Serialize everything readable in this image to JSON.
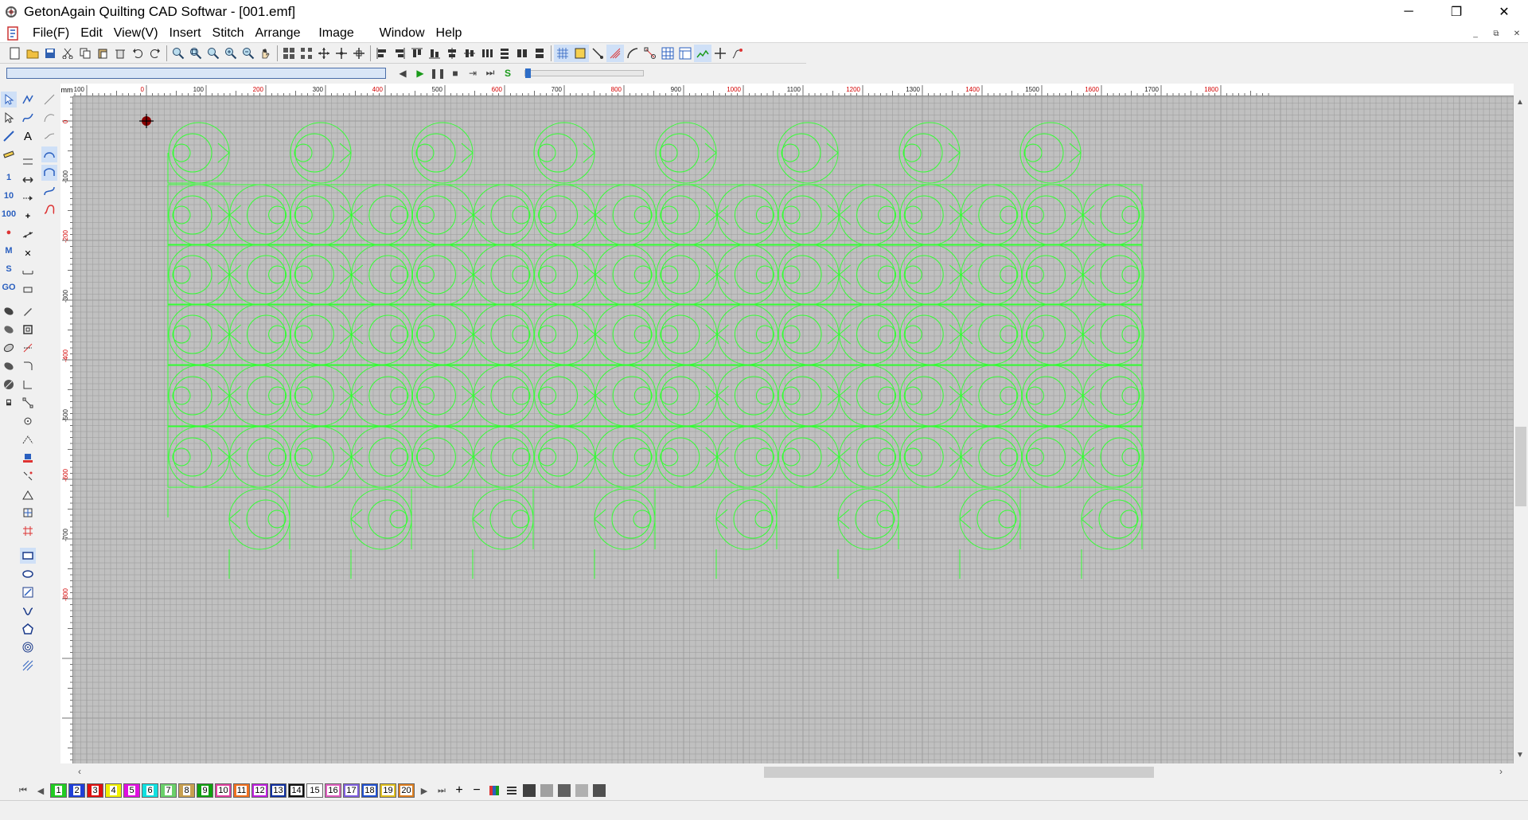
{
  "window": {
    "title": "GetonAgain Quilting CAD Softwar - [001.emf]",
    "controls": {
      "minimize": "─",
      "maximize": "❐",
      "close": "✕"
    }
  },
  "menu": {
    "items": [
      "File(F)",
      "Edit",
      "View(V)",
      "Insert",
      "Stitch",
      "Arrange",
      "  Image",
      "    Window",
      "Help"
    ],
    "mdi": {
      "minimize": "_",
      "restore": "⧉",
      "close": "✕"
    }
  },
  "ruler": {
    "unit": "mm",
    "x_ticks": [
      "-100",
      "0",
      "100",
      "200",
      "300",
      "400",
      "500",
      "600",
      "700",
      "800",
      "900",
      "1000",
      "1100",
      "1200",
      "1300",
      "1400",
      "1500",
      "1600",
      "1700",
      "1800"
    ],
    "y_ticks": [
      "0",
      "-100",
      "-200",
      "-300",
      "-400",
      "-500",
      "-600",
      "-700",
      "-800"
    ],
    "x_red": [
      "0",
      "200",
      "400",
      "600",
      "800",
      "1000",
      "1200",
      "1400",
      "1600",
      "1800"
    ],
    "y_red": [
      "0",
      "-200",
      "-400",
      "-600",
      "-800"
    ]
  },
  "colors": {
    "canvas_bg": "#c0c0c0",
    "grid": "#9a9a9a",
    "pattern_stroke": "#33ff33",
    "ruler_red": "#d40000",
    "origin_marker": "#8b0000"
  },
  "colorbar": {
    "swatches": [
      {
        "label": "1",
        "color": "#22cc22"
      },
      {
        "label": "2",
        "color": "#1f3fd8"
      },
      {
        "label": "3",
        "color": "#e01010"
      },
      {
        "label": "4",
        "color": "#f0f000"
      },
      {
        "label": "5",
        "color": "#e010e0"
      },
      {
        "label": "6",
        "color": "#10e0e0"
      },
      {
        "label": "7",
        "color": "#6ad06a"
      },
      {
        "label": "8",
        "color": "#c8a050"
      },
      {
        "label": "9",
        "color": "#10a010"
      },
      {
        "label": "10",
        "color": "#e040a0"
      },
      {
        "label": "11",
        "color": "#f07020"
      },
      {
        "label": "12",
        "color": "#c020e0"
      },
      {
        "label": "13",
        "color": "#1030a0"
      },
      {
        "label": "14",
        "color": "#101010"
      },
      {
        "label": "15",
        "color": "#ffffff"
      },
      {
        "label": "16",
        "color": "#e060c0"
      },
      {
        "label": "17",
        "color": "#8060e0"
      },
      {
        "label": "18",
        "color": "#2050d0"
      },
      {
        "label": "19",
        "color": "#e0c020"
      },
      {
        "label": "20",
        "color": "#e08020"
      }
    ],
    "grays": [
      "#404040",
      "#a0a0a0",
      "#606060",
      "#b0b0b0",
      "#505050"
    ]
  },
  "icons": {
    "new": "new-file-icon",
    "open": "open-folder-icon",
    "save": "save-icon",
    "cut": "cut-icon",
    "copy": "copy-icon",
    "paste": "paste-icon",
    "delete": "trash-icon",
    "undo": "undo-icon",
    "redo": "redo-icon",
    "pan": "hand-icon"
  }
}
